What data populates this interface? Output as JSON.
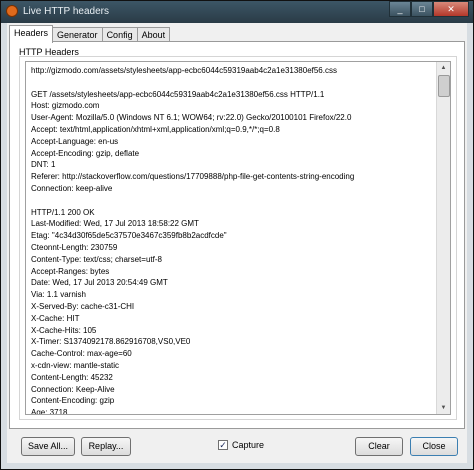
{
  "window": {
    "title": "Live HTTP headers"
  },
  "tabs": [
    "Headers",
    "Generator",
    "Config",
    "About"
  ],
  "panel": {
    "group_label": "HTTP Headers"
  },
  "lines": [
    "http://gizmodo.com/assets/stylesheets/app-ecbc6044c59319aab4c2a1e31380ef56.css",
    "",
    "GET /assets/stylesheets/app-ecbc6044c59319aab4c2a1e31380ef56.css HTTP/1.1",
    "Host: gizmodo.com",
    "User-Agent: Mozilla/5.0 (Windows NT 6.1; WOW64; rv:22.0) Gecko/20100101 Firefox/22.0",
    "Accept: text/html,application/xhtml+xml,application/xml;q=0.9,*/*;q=0.8",
    "Accept-Language: en-us",
    "Accept-Encoding: gzip, deflate",
    "DNT: 1",
    "Referer: http://stackoverflow.com/questions/17709888/php-file-get-contents-string-encoding",
    "Connection: keep-alive",
    "",
    "HTTP/1.1 200 OK",
    "Last-Modified: Wed, 17 Jul 2013 18:58:22 GMT",
    "Etag: \"4c34d30f65de5c37570e3467c359fb8b2acdfcde\"",
    "Cteonnt-Length: 230759",
    "Content-Type: text/css; charset=utf-8",
    "Accept-Ranges: bytes",
    "Date: Wed, 17 Jul 2013 20:54:49 GMT",
    "Via: 1.1 varnish",
    "X-Served-By: cache-c31-CHI",
    "X-Cache: HIT",
    "X-Cache-Hits: 105",
    "X-Timer: S1374092178.862916708,VS0,VE0",
    "Cache-Control: max-age=60",
    "x-cdn-view: mantle-static",
    "Content-Length: 45232",
    "Connection: Keep-Alive",
    "Content-Encoding: gzip",
    "Age: 3718"
  ],
  "buttons": {
    "save_all": "Save All...",
    "replay": "Replay...",
    "clear": "Clear",
    "close": "Close"
  },
  "capture": {
    "label": "Capture",
    "checked": true
  },
  "icons": {
    "app": "firefox-icon",
    "minimize": "minimize-icon",
    "maximize": "maximize-icon",
    "close": "close-icon",
    "scroll_up": "arrow-up-icon",
    "scroll_down": "arrow-down-icon"
  }
}
